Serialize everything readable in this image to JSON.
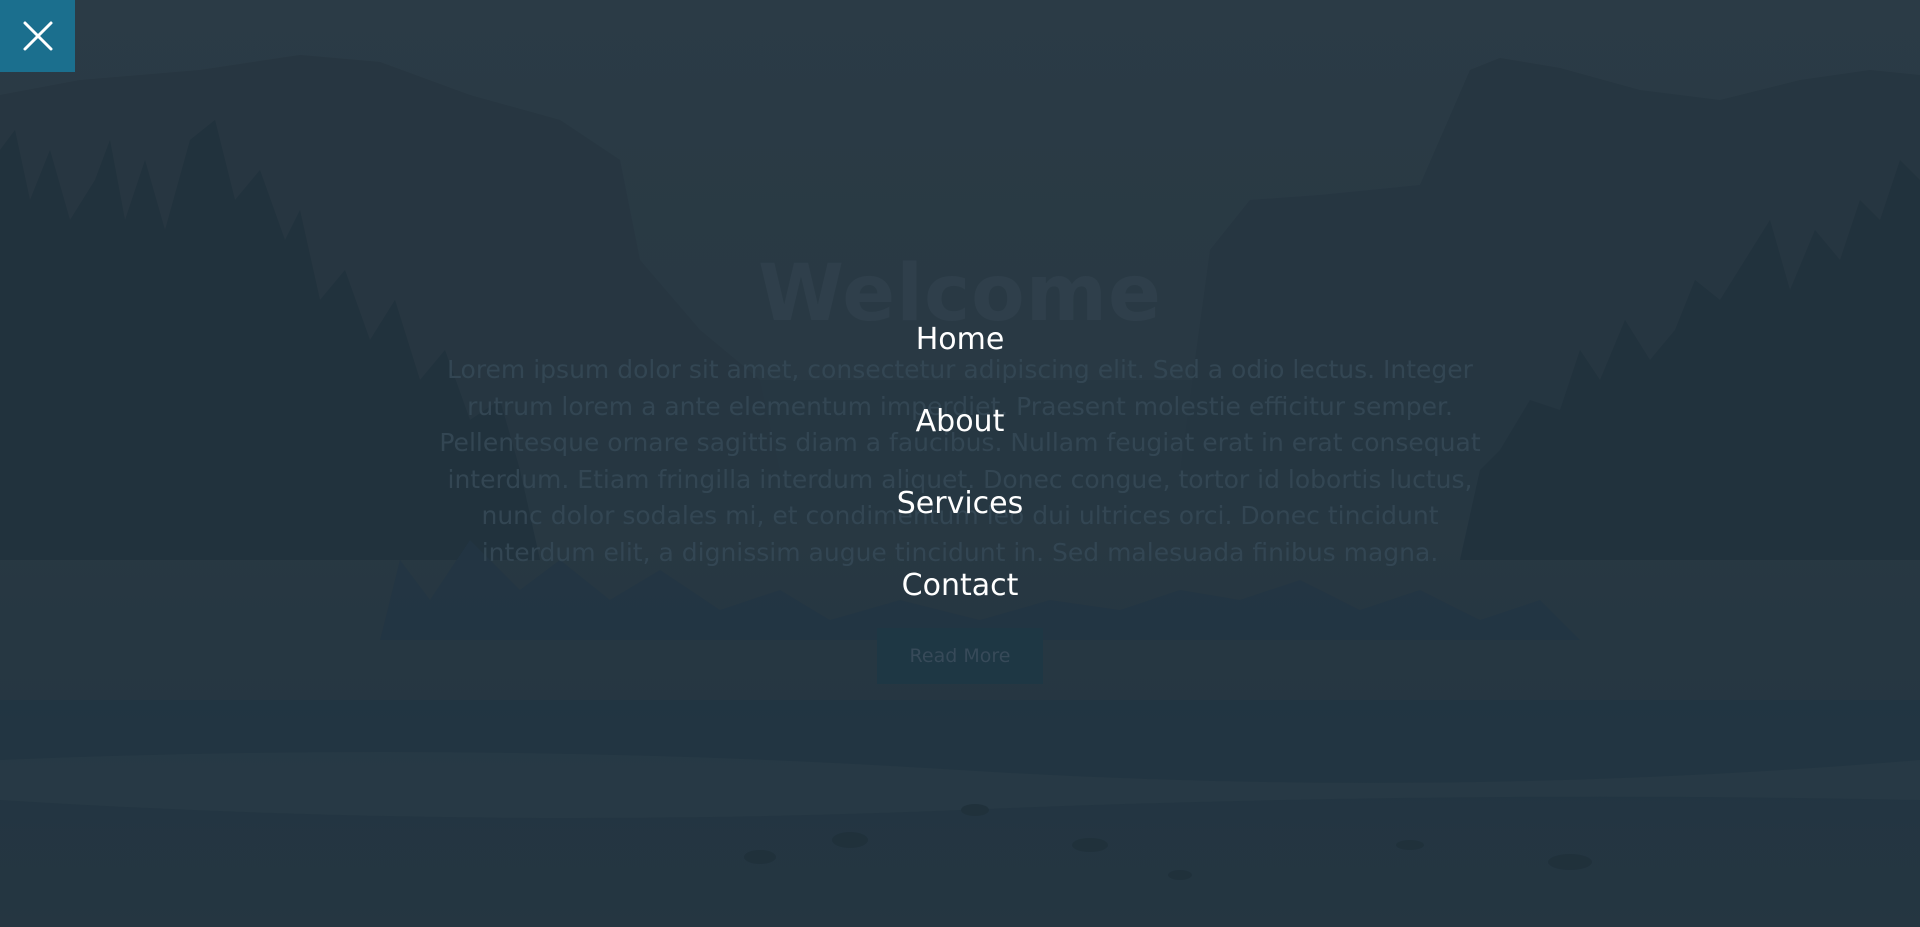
{
  "hero": {
    "title": "Welcome",
    "paragraph": "Lorem ipsum dolor sit amet, consectetur adipiscing elit. Sed a odio lectus. Integer rutrum lorem a ante elementum imperdiet. Praesent molestie efficitur semper. Pellentesque ornare sagittis diam a faucibus. Nullam feugiat erat in erat consequat interdum. Etiam fringilla interdum aliquet. Donec congue, tortor id lobortis luctus, nunc dolor sodales mi, et condimentum leo dui ultrices orci. Donec tincidunt interdum elit, a dignissim augue tincidunt in. Sed malesuada finibus magna.",
    "read_more_label": "Read More"
  },
  "menu": {
    "items": [
      {
        "label": "Home"
      },
      {
        "label": "About"
      },
      {
        "label": "Services"
      },
      {
        "label": "Contact"
      }
    ],
    "close_icon": "close-icon"
  },
  "colors": {
    "close_button": "#1b6f8e",
    "menu_text": "#ffffff",
    "overlay": "#1e2d3a"
  }
}
